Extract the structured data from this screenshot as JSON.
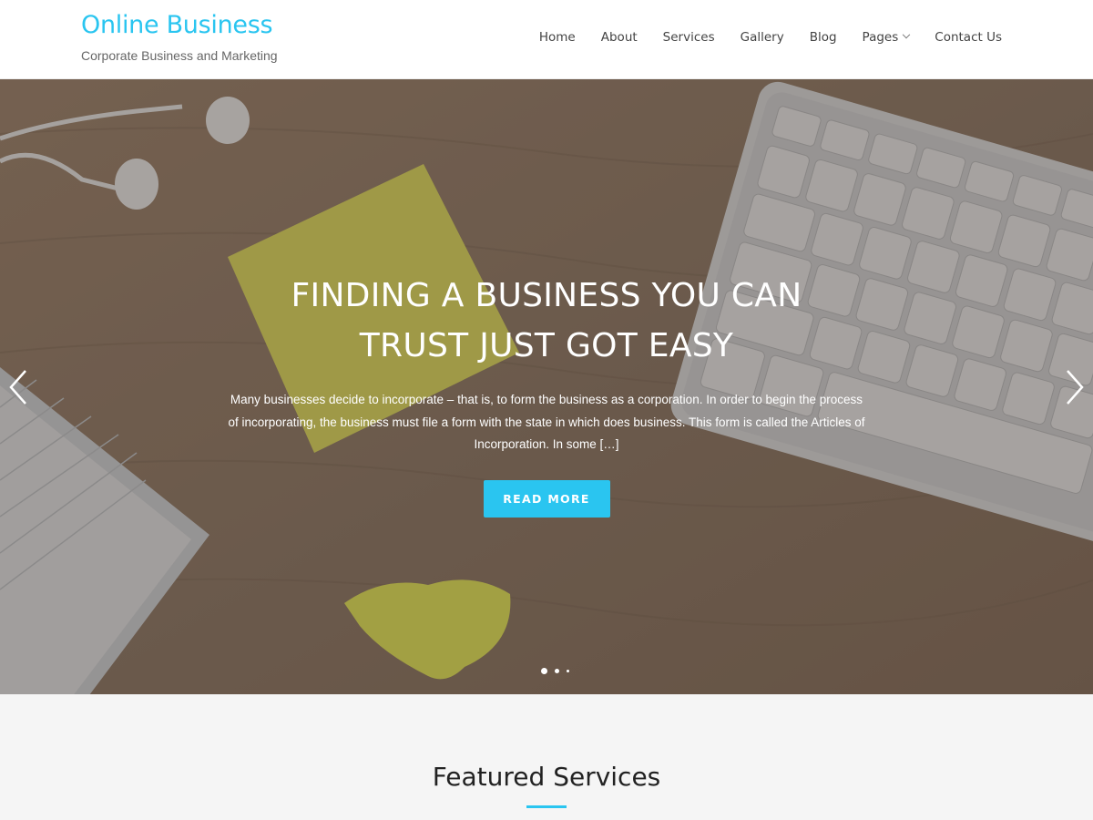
{
  "site": {
    "title": "Online Business",
    "tagline": "Corporate Business and Marketing",
    "accent_color": "#2ac5f0"
  },
  "nav": {
    "items": [
      {
        "label": "Home"
      },
      {
        "label": "About"
      },
      {
        "label": "Services"
      },
      {
        "label": "Gallery"
      },
      {
        "label": "Blog"
      },
      {
        "label": "Pages",
        "has_dropdown": true
      },
      {
        "label": "Contact Us"
      }
    ]
  },
  "hero": {
    "title_line1": "FINDING A BUSINESS YOU CAN",
    "title_line2": "TRUST JUST GOT EASY",
    "text": "Many businesses decide to incorporate – that is, to form the business as a corporation. In order to begin the process of incorporating, the business must file a form with the state in which does business. This form is called the Articles of Incorporation. In some […]",
    "button_label": "READ MORE",
    "slides_total": 3,
    "active_slide": 1,
    "prev_icon": "chevron-left-icon",
    "next_icon": "chevron-right-icon"
  },
  "featured": {
    "heading": "Featured Services"
  }
}
